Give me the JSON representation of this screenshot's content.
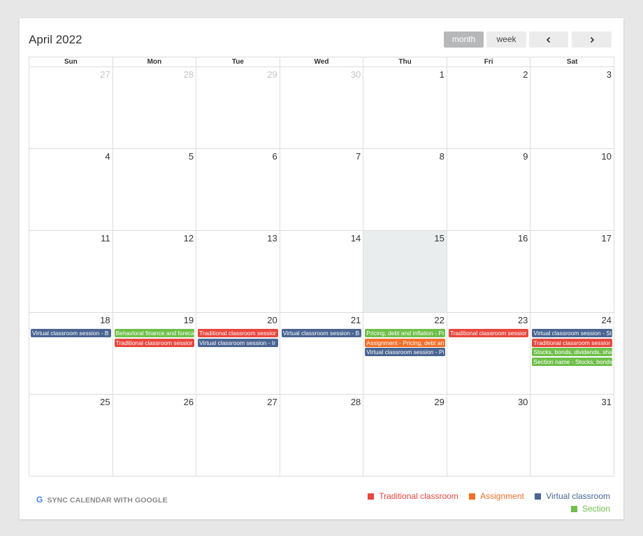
{
  "header": {
    "title": "April 2022"
  },
  "controls": {
    "month_label": "month",
    "week_label": "week"
  },
  "weekdays": [
    "Sun",
    "Mon",
    "Tue",
    "Wed",
    "Thu",
    "Fri",
    "Sat"
  ],
  "colors": {
    "traditional": "#e8473d",
    "assignment": "#f36f2a",
    "virtual": "#4a6592",
    "section": "#6fbf4a"
  },
  "weeks": [
    [
      {
        "day": "27",
        "other": true,
        "events": []
      },
      {
        "day": "28",
        "other": true,
        "events": []
      },
      {
        "day": "29",
        "other": true,
        "events": []
      },
      {
        "day": "30",
        "other": true,
        "events": []
      },
      {
        "day": "1",
        "events": []
      },
      {
        "day": "2",
        "events": []
      },
      {
        "day": "3",
        "events": []
      }
    ],
    [
      {
        "day": "4",
        "events": []
      },
      {
        "day": "5",
        "events": []
      },
      {
        "day": "6",
        "events": []
      },
      {
        "day": "7",
        "events": []
      },
      {
        "day": "8",
        "events": []
      },
      {
        "day": "9",
        "events": []
      },
      {
        "day": "10",
        "events": []
      }
    ],
    [
      {
        "day": "11",
        "events": []
      },
      {
        "day": "12",
        "events": []
      },
      {
        "day": "13",
        "events": []
      },
      {
        "day": "14",
        "events": []
      },
      {
        "day": "15",
        "today": true,
        "events": []
      },
      {
        "day": "16",
        "events": []
      },
      {
        "day": "17",
        "events": []
      }
    ],
    [
      {
        "day": "18",
        "events": [
          {
            "title": "Virtual classroom session - B",
            "type": "virtual"
          }
        ]
      },
      {
        "day": "19",
        "events": [
          {
            "title": "Behavioral finance and foreca",
            "type": "section"
          },
          {
            "title": "Traditional classroom sessior",
            "type": "traditional"
          }
        ]
      },
      {
        "day": "20",
        "events": [
          {
            "title": "Traditional classroom sessior",
            "type": "traditional"
          },
          {
            "title": "Virtual classroom session - Ir",
            "type": "virtual"
          }
        ]
      },
      {
        "day": "21",
        "events": [
          {
            "title": "Virtual classroom session - B",
            "type": "virtual"
          }
        ]
      },
      {
        "day": "22",
        "events": [
          {
            "title": "Pricing, debt and inflation - Pr",
            "type": "section"
          },
          {
            "title": "Assignment - Pricing, debt an",
            "type": "assignment"
          },
          {
            "title": "Virtual classroom session - Pi",
            "type": "virtual"
          }
        ]
      },
      {
        "day": "23",
        "events": [
          {
            "title": "Traditional classroom sessior",
            "type": "traditional"
          }
        ]
      },
      {
        "day": "24",
        "events": [
          {
            "title": "Virtual classroom session - St",
            "type": "virtual"
          },
          {
            "title": "Traditional classroom sessior",
            "type": "traditional"
          },
          {
            "title": "Stocks, bonds, dividends, sha",
            "type": "section"
          },
          {
            "title": "Section name - Stocks, bonds",
            "type": "section"
          }
        ]
      }
    ],
    [
      {
        "day": "25",
        "events": []
      },
      {
        "day": "26",
        "events": []
      },
      {
        "day": "27",
        "events": []
      },
      {
        "day": "28",
        "events": []
      },
      {
        "day": "29",
        "events": []
      },
      {
        "day": "30",
        "events": []
      },
      {
        "day": "31",
        "events": []
      }
    ]
  ],
  "footer": {
    "sync_label": "SYNC CALENDAR WITH GOOGLE",
    "google_icon": "G"
  },
  "legend": [
    {
      "label": "Traditional classroom",
      "type": "traditional"
    },
    {
      "label": "Assignment",
      "type": "assignment"
    },
    {
      "label": "Virtual classroom",
      "type": "virtual"
    },
    {
      "label": "Section",
      "type": "section"
    }
  ]
}
